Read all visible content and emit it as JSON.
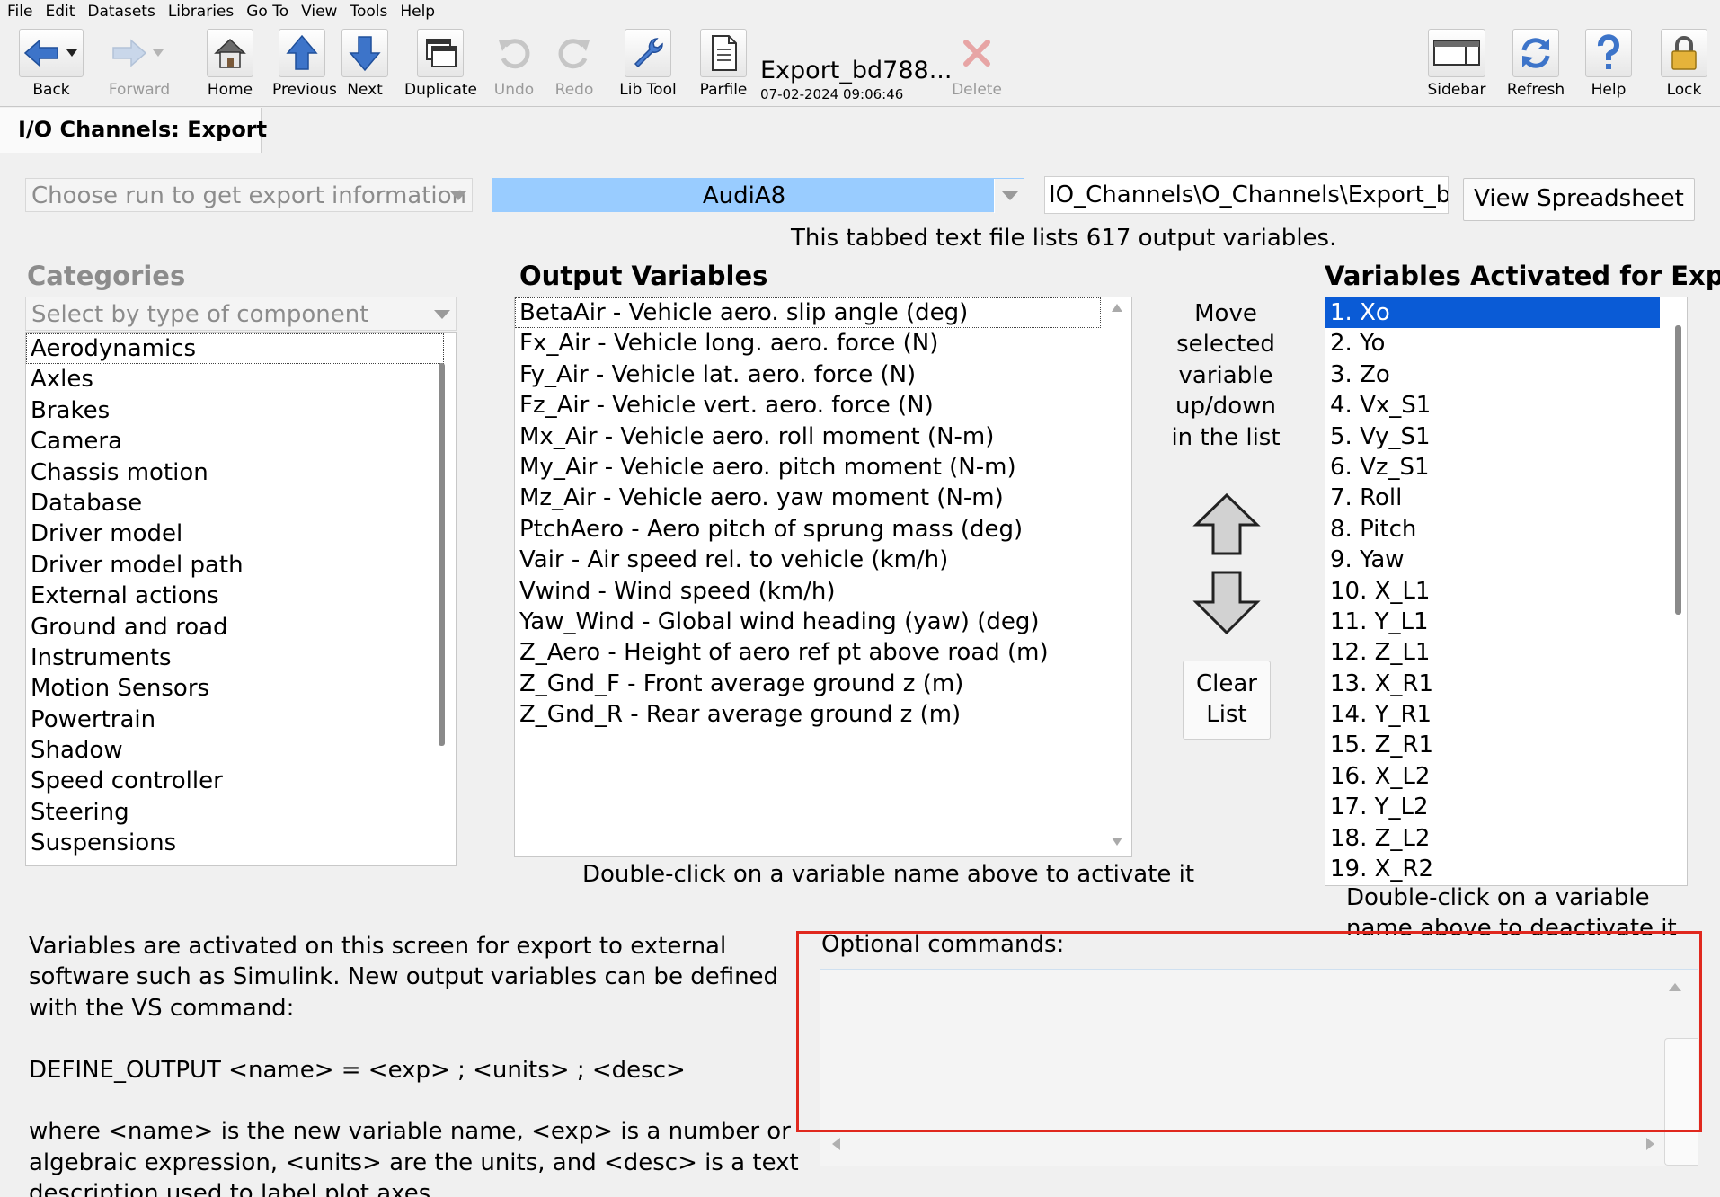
{
  "menu": [
    "File",
    "Edit",
    "Datasets",
    "Libraries",
    "Go To",
    "View",
    "Tools",
    "Help"
  ],
  "toolbar": {
    "back": "Back",
    "forward": "Forward",
    "home": "Home",
    "previous": "Previous",
    "next": "Next",
    "duplicate": "Duplicate",
    "undo": "Undo",
    "redo": "Redo",
    "lib_tool": "Lib Tool",
    "parfile": "Parfile",
    "parfile_title": "Export_bd788...",
    "parfile_date": "07-02-2024 09:06:46",
    "delete": "Delete",
    "sidebar": "Sidebar",
    "refresh": "Refresh",
    "help": "Help",
    "lock": "Lock"
  },
  "tab": {
    "title": "I/O Channels: Export"
  },
  "controls": {
    "run_combo": "Choose run to get export information",
    "vehicle": "AudiA8",
    "path": "IO_Channels\\O_Channels\\Export_bd",
    "view_spreadsheet": "View Spreadsheet",
    "info": "This tabbed text file lists 617 output variables."
  },
  "categories": {
    "heading": "Categories",
    "type_combo": "Select by type of component",
    "items": [
      "Aerodynamics",
      "Axles",
      "Brakes",
      "Camera",
      "Chassis motion",
      "Database",
      "Driver model",
      "Driver model path",
      "External actions",
      "Ground and road",
      "Instruments",
      "Motion Sensors",
      "Powertrain",
      "Shadow",
      "Speed controller",
      "Steering",
      "Suspensions"
    ]
  },
  "output": {
    "heading": "Output Variables",
    "items": [
      "BetaAir - Vehicle aero. slip angle (deg)",
      "Fx_Air - Vehicle long. aero. force (N)",
      "Fy_Air - Vehicle lat. aero. force (N)",
      "Fz_Air - Vehicle vert. aero. force (N)",
      "Mx_Air - Vehicle aero. roll moment (N-m)",
      "My_Air - Vehicle aero. pitch moment (N-m)",
      "Mz_Air - Vehicle aero. yaw moment (N-m)",
      "PtchAero - Aero pitch of sprung mass (deg)",
      "Vair - Air speed rel. to vehicle (km/h)",
      "Vwind - Wind speed (km/h)",
      "Yaw_Wind - Global wind heading (yaw) (deg)",
      "Z_Aero - Height of aero ref pt above road (m)",
      "Z_Gnd_F - Front average ground z (m)",
      "Z_Gnd_R - Rear average ground z (m)"
    ],
    "hint": "Double-click on a variable name above to activate it"
  },
  "move": {
    "text": [
      "Move",
      "selected",
      "variable",
      "up/down",
      "in the list"
    ],
    "clear_line1": "Clear",
    "clear_line2": "List"
  },
  "activated": {
    "heading": "Variables Activated for Export",
    "items": [
      "1. Xo",
      "2. Yo",
      "3. Zo",
      "4. Vx_S1",
      "5. Vy_S1",
      "6. Vz_S1",
      "7. Roll",
      "8. Pitch",
      "9. Yaw",
      "10. X_L1",
      "11. Y_L1",
      "12. Z_L1",
      "13. X_R1",
      "14. Y_R1",
      "15. Z_R1",
      "16. X_L2",
      "17. Y_L2",
      "18. Z_L2",
      "19. X_R2"
    ],
    "hint": "Double-click on a variable name above to deactivate it"
  },
  "description": [
    "Variables are activated on this screen for export to external software such as Simulink. New output variables can be defined with the VS command:",
    "DEFINE_OUTPUT <name> = <exp> ; <units> ; <desc>",
    "where <name> is the new variable name,  <exp> is a number or algebraic expression, <units> are the units, and <desc> is a text description used to label plot axes."
  ],
  "optional": {
    "label": "Optional commands:",
    "value": ""
  },
  "colors": {
    "selection": "#0a5bd6",
    "vehicle_combo": "#99ccff",
    "highlight": "#e0281e"
  }
}
